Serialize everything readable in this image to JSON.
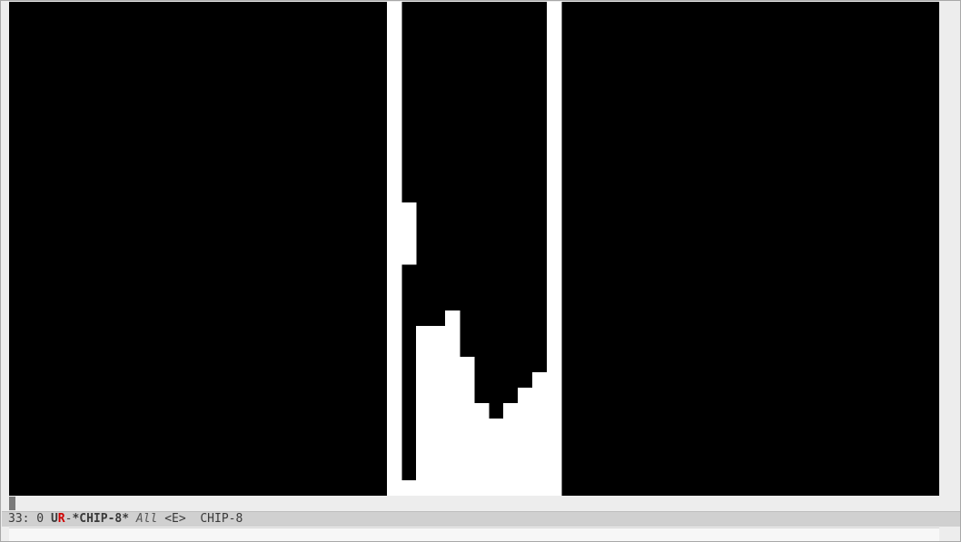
{
  "colors": {
    "pixel_on": "#ffffff",
    "pixel_off": "#000000",
    "modeline_bg": "#d0d0d0",
    "modified_flag": "#d00000"
  },
  "display": {
    "resolution": [
      64,
      32
    ],
    "lit_pixel_rows": [
      {
        "row": 0,
        "cols": [
          26,
          37
        ]
      },
      {
        "row": 1,
        "cols": [
          26,
          37
        ]
      },
      {
        "row": 2,
        "cols": [
          26,
          37
        ]
      },
      {
        "row": 3,
        "cols": [
          26,
          37
        ]
      },
      {
        "row": 4,
        "cols": [
          26,
          37
        ]
      },
      {
        "row": 5,
        "cols": [
          26,
          37
        ]
      },
      {
        "row": 6,
        "cols": [
          26,
          37
        ]
      },
      {
        "row": 7,
        "cols": [
          26,
          37
        ]
      },
      {
        "row": 8,
        "cols": [
          26,
          37
        ]
      },
      {
        "row": 9,
        "cols": [
          26,
          37
        ]
      },
      {
        "row": 10,
        "cols": [
          26,
          37
        ]
      },
      {
        "row": 11,
        "cols": [
          26,
          37
        ]
      },
      {
        "row": 12,
        "cols": [
          26,
          37
        ]
      },
      {
        "row": 13,
        "cols": [
          26,
          27,
          37
        ]
      },
      {
        "row": 14,
        "cols": [
          26,
          27,
          37
        ]
      },
      {
        "row": 15,
        "cols": [
          26,
          27,
          37
        ]
      },
      {
        "row": 16,
        "cols": [
          26,
          27,
          37
        ]
      },
      {
        "row": 17,
        "cols": [
          26,
          37
        ]
      },
      {
        "row": 18,
        "cols": [
          26,
          37
        ]
      },
      {
        "row": 19,
        "cols": [
          26,
          37
        ]
      },
      {
        "row": 20,
        "cols": [
          26,
          30,
          37
        ]
      },
      {
        "row": 21,
        "cols": [
          26,
          28,
          29,
          30,
          37
        ]
      },
      {
        "row": 22,
        "cols": [
          26,
          28,
          29,
          30,
          37
        ]
      },
      {
        "row": 23,
        "cols": [
          26,
          28,
          29,
          30,
          31,
          37
        ]
      },
      {
        "row": 24,
        "cols": [
          26,
          28,
          29,
          30,
          31,
          36,
          37
        ]
      },
      {
        "row": 25,
        "cols": [
          26,
          28,
          29,
          30,
          31,
          35,
          36,
          37
        ]
      },
      {
        "row": 26,
        "cols": [
          26,
          28,
          29,
          30,
          31,
          32,
          34,
          35,
          36,
          37
        ]
      },
      {
        "row": 27,
        "cols": [
          26,
          28,
          29,
          30,
          31,
          32,
          33,
          34,
          35,
          36,
          37
        ]
      },
      {
        "row": 28,
        "cols": [
          26,
          28,
          29,
          30,
          31,
          32,
          33,
          34,
          35,
          36,
          37
        ]
      },
      {
        "row": 29,
        "cols": [
          26,
          28,
          29,
          30,
          31,
          32,
          33,
          34,
          35,
          36,
          37
        ]
      },
      {
        "row": 30,
        "cols": [
          26,
          28,
          29,
          30,
          31,
          32,
          33,
          34,
          35,
          36,
          37
        ]
      },
      {
        "row": 31,
        "cols": [
          26,
          27,
          28,
          29,
          30,
          31,
          32,
          33,
          34,
          35,
          36,
          37
        ]
      }
    ]
  },
  "mode_line": {
    "position": "33: 0",
    "coding": "U",
    "modified": "R",
    "separator": "-",
    "buffer_name": "*CHIP-8*",
    "scroll": "All",
    "evil_state": "<E>",
    "major_mode": "CHIP-8"
  },
  "minibuffer": {
    "text": ""
  }
}
